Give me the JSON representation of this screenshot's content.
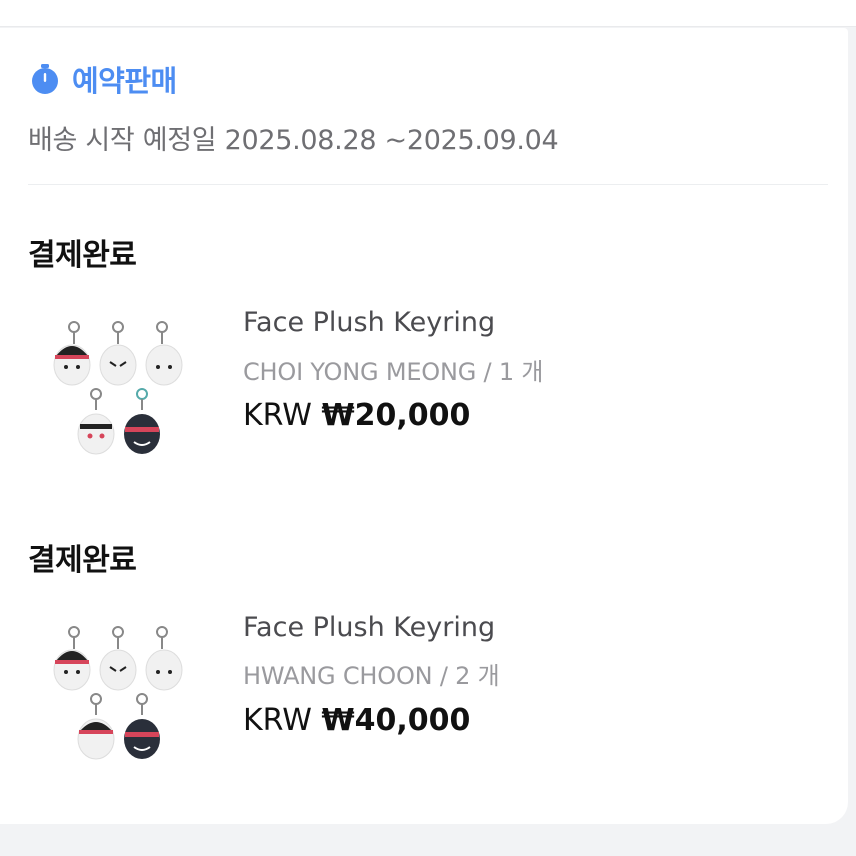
{
  "presale": {
    "icon": "stopwatch-icon",
    "label": "예약판매",
    "shipping_text": "배송 시작 예정일 2025.08.28 ~2025.09.04",
    "accent": "#4d8df2"
  },
  "orders": [
    {
      "status": "결제완료",
      "product_name": "Face Plush Keyring",
      "option": "CHOI YONG MEONG / 1 개",
      "currency": "KRW",
      "amount": "₩20,000",
      "thumbnail_icon": "plush-keyring-image"
    },
    {
      "status": "결제완료",
      "product_name": "Face Plush Keyring",
      "option": "HWANG CHOON / 2 개",
      "currency": "KRW",
      "amount": "₩40,000",
      "thumbnail_icon": "plush-keyring-image"
    }
  ]
}
